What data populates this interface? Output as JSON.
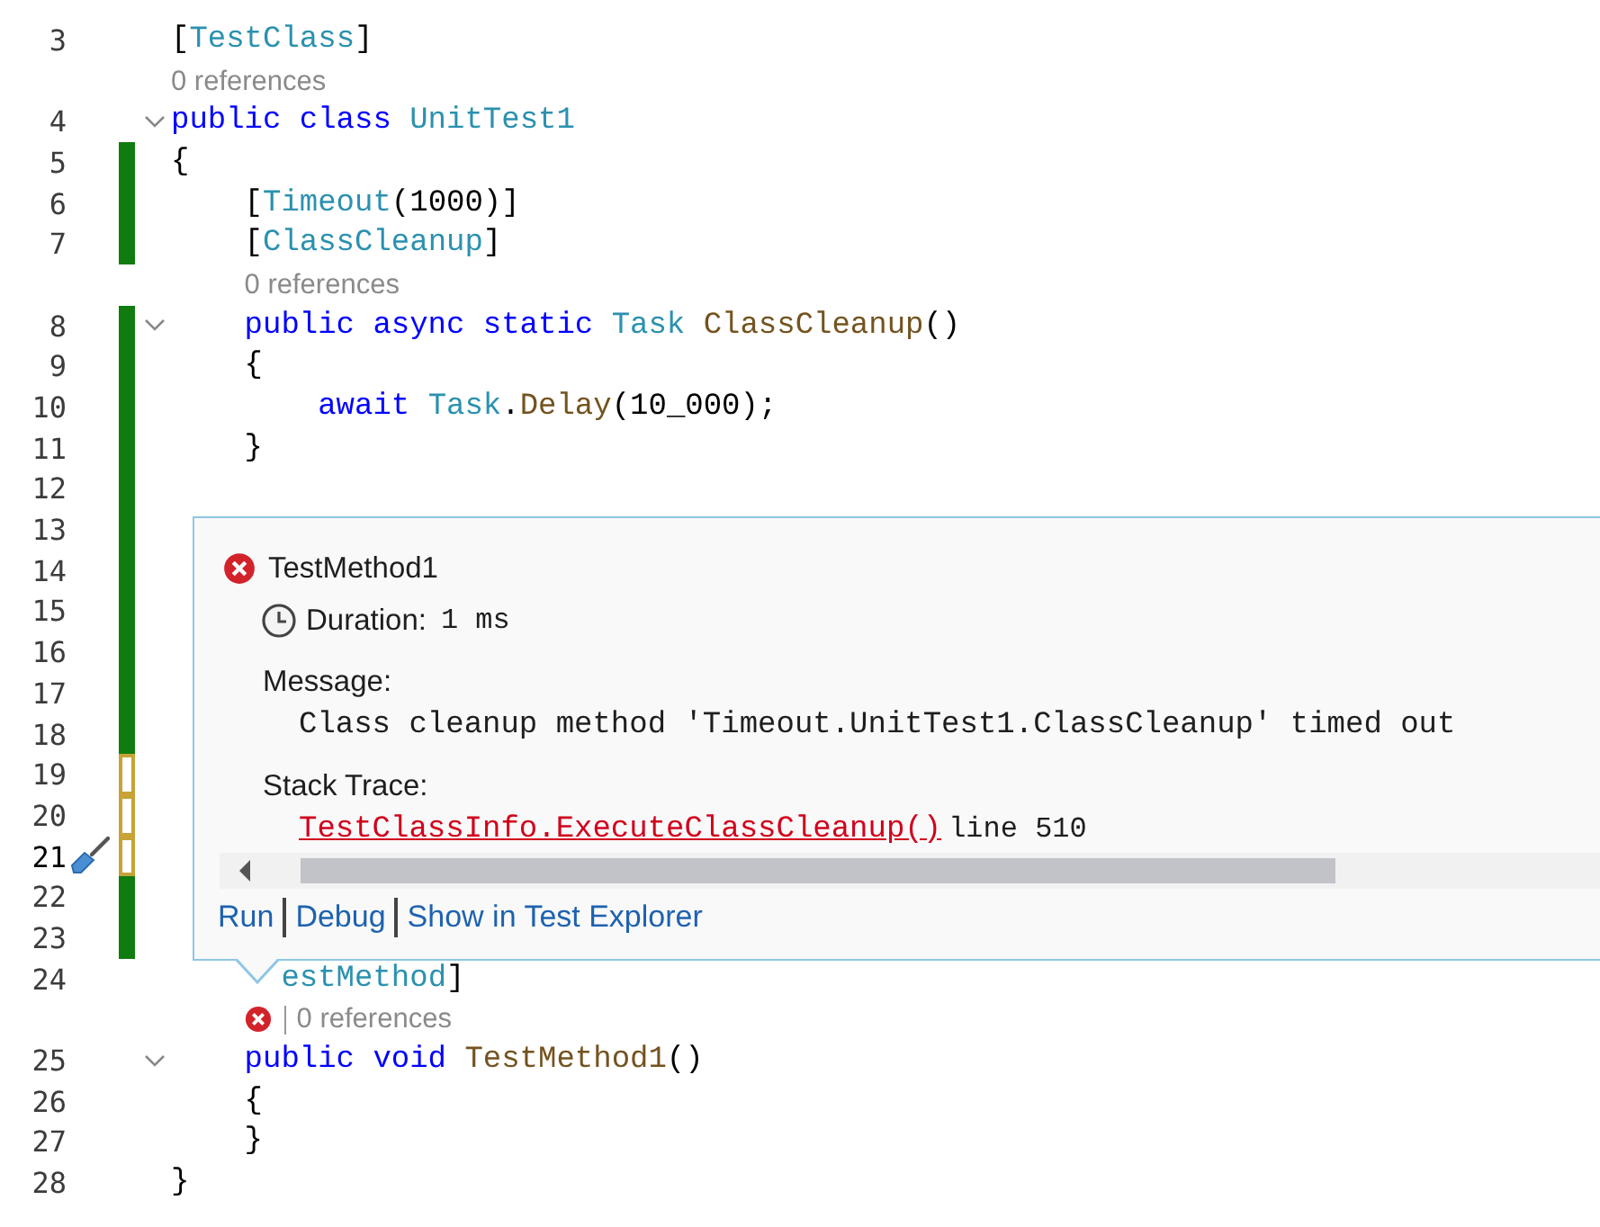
{
  "editor": {
    "lines": [
      {
        "kind": "code",
        "number": "3",
        "current": false,
        "modified": false,
        "collapsible": false,
        "tokens": [
          {
            "kind": "plain",
            "text": "["
          },
          {
            "kind": "type",
            "text": "TestClass"
          },
          {
            "kind": "plain",
            "text": "]"
          }
        ]
      },
      {
        "kind": "lens",
        "failed": false,
        "text": "0 references"
      },
      {
        "kind": "code",
        "number": "4",
        "current": false,
        "modified": false,
        "collapsible": true,
        "tokens": [
          {
            "kind": "keyword",
            "text": "public"
          },
          {
            "kind": "keyword",
            "text": "class"
          },
          {
            "kind": "type",
            "text": "UnitTest1"
          }
        ]
      },
      {
        "kind": "code",
        "number": "5",
        "current": false,
        "modified": true,
        "saved": true,
        "collapsible": false,
        "tokens": [
          {
            "kind": "plain",
            "text": "{"
          }
        ],
        "children": [
          {
            "kind": "code",
            "number": "6",
            "current": false,
            "modified": true,
            "saved": true,
            "collapsible": false,
            "tokens": [
              {
                "kind": "plain",
                "text": "["
              },
              {
                "kind": "type",
                "text": "Timeout"
              },
              {
                "kind": "plain",
                "text": "(1000)]"
              }
            ]
          },
          {
            "kind": "code",
            "number": "7",
            "current": false,
            "modified": true,
            "saved": true,
            "collapsible": false,
            "tokens": [
              {
                "kind": "plain",
                "text": "["
              },
              {
                "kind": "type",
                "text": "ClassCleanup"
              },
              {
                "kind": "plain",
                "text": "]"
              }
            ]
          },
          {
            "kind": "lens",
            "failed": false,
            "text": "0 references"
          },
          {
            "kind": "code",
            "number": "8",
            "current": false,
            "modified": true,
            "saved": true,
            "collapsible": true,
            "tokens": [
              {
                "kind": "keyword",
                "text": "public"
              },
              {
                "kind": "keyword",
                "text": "async"
              },
              {
                "kind": "keyword",
                "text": "static"
              },
              {
                "kind": "type",
                "text": "Task"
              },
              {
                "kind": "method",
                "text": "ClassCleanup"
              },
              {
                "kind": "plain",
                "text": "()"
              }
            ]
          },
          {
            "kind": "code",
            "number": "9",
            "current": false,
            "modified": true,
            "saved": true,
            "collapsible": false,
            "tokens": [
              {
                "kind": "plain",
                "text": "{"
              }
            ],
            "children": [
              {
                "kind": "code",
                "number": "10",
                "current": false,
                "modified": true,
                "saved": true,
                "collapsible": false,
                "tokens": [
                  {
                    "kind": "keyword",
                    "text": "await"
                  },
                  {
                    "kind": "type",
                    "text": "Task"
                  },
                  {
                    "kind": "plain",
                    "text": "."
                  },
                  {
                    "kind": "method",
                    "text": "Delay"
                  },
                  {
                    "kind": "plain",
                    "text": "(10_000);"
                  }
                ]
              }
            ]
          },
          {
            "kind": "code",
            "number": "11",
            "current": false,
            "modified": true,
            "saved": true,
            "collapsible": false,
            "tokens": [
              {
                "kind": "plain",
                "text": "}"
              }
            ]
          },
          {
            "kind": "code",
            "number": "12",
            "current": false,
            "modified": true,
            "saved": true,
            "collapsible": false
          },
          {
            "kind": "code",
            "number": "13",
            "current": false,
            "modified": true,
            "saved": true,
            "collapsible": false
          },
          {
            "kind": "code",
            "number": "14",
            "current": false,
            "modified": true,
            "saved": true,
            "collapsible": false
          },
          {
            "kind": "code",
            "number": "15",
            "current": false,
            "modified": true,
            "saved": true,
            "collapsible": false
          },
          {
            "kind": "code",
            "number": "16",
            "current": false,
            "modified": true,
            "saved": true,
            "collapsible": false
          },
          {
            "kind": "code",
            "number": "17",
            "current": false,
            "modified": true,
            "saved": true,
            "collapsible": false
          },
          {
            "kind": "code",
            "number": "18",
            "current": false,
            "modified": true,
            "saved": true,
            "collapsible": false
          },
          {
            "kind": "code",
            "number": "19",
            "current": false,
            "modified": true,
            "saved": false,
            "collapsible": false
          },
          {
            "kind": "code",
            "number": "20",
            "current": false,
            "modified": true,
            "saved": false,
            "collapsible": false
          },
          {
            "kind": "code",
            "number": "21",
            "current": true,
            "modified": true,
            "saved": false,
            "collapsible": false,
            "quick_actions": true
          },
          {
            "kind": "code",
            "number": "22",
            "current": false,
            "modified": true,
            "saved": true,
            "collapsible": false
          },
          {
            "kind": "code",
            "number": "23",
            "current": false,
            "modified": true,
            "saved": true,
            "collapsible": false
          },
          {
            "kind": "code",
            "number": "24",
            "current": false,
            "modified": false,
            "collapsible": false,
            "covered": true,
            "tokens": [
              {
                "kind": "type",
                "text": "estMethod"
              },
              {
                "kind": "plain",
                "text": "]"
              }
            ]
          },
          {
            "kind": "lens",
            "failed": true,
            "text": "0 references"
          },
          {
            "kind": "code",
            "number": "25",
            "current": false,
            "modified": false,
            "collapsible": true,
            "tokens": [
              {
                "kind": "keyword",
                "text": "public"
              },
              {
                "kind": "keyword",
                "text": "void"
              },
              {
                "kind": "method",
                "text": "TestMethod1"
              },
              {
                "kind": "plain",
                "text": "()"
              }
            ]
          },
          {
            "kind": "code",
            "number": "26",
            "current": false,
            "modified": false,
            "collapsible": false,
            "tokens": [
              {
                "kind": "plain",
                "text": "{"
              }
            ]
          },
          {
            "kind": "code",
            "number": "27",
            "current": false,
            "modified": false,
            "collapsible": false,
            "tokens": [
              {
                "kind": "plain",
                "text": "}"
              }
            ]
          }
        ]
      },
      {
        "kind": "code",
        "number": "28",
        "current": false,
        "modified": false,
        "collapsible": false,
        "tokens": [
          {
            "kind": "plain",
            "text": "}"
          }
        ]
      }
    ]
  },
  "test_popup": {
    "failed": true,
    "test_name": "TestMethod1",
    "duration_label": "Duration:",
    "duration": "1 ms",
    "message_label": "Message:",
    "message": "Class cleanup method 'Timeout.UnitTest1.ClassCleanup' timed out",
    "stack_label": "Stack Trace:",
    "stack_frames": [
      {
        "method": "TestClassInfo.ExecuteClassCleanup()",
        "location": "line 510"
      }
    ],
    "actions": [
      "Run",
      "Debug",
      "Show in Test Explorer"
    ]
  }
}
